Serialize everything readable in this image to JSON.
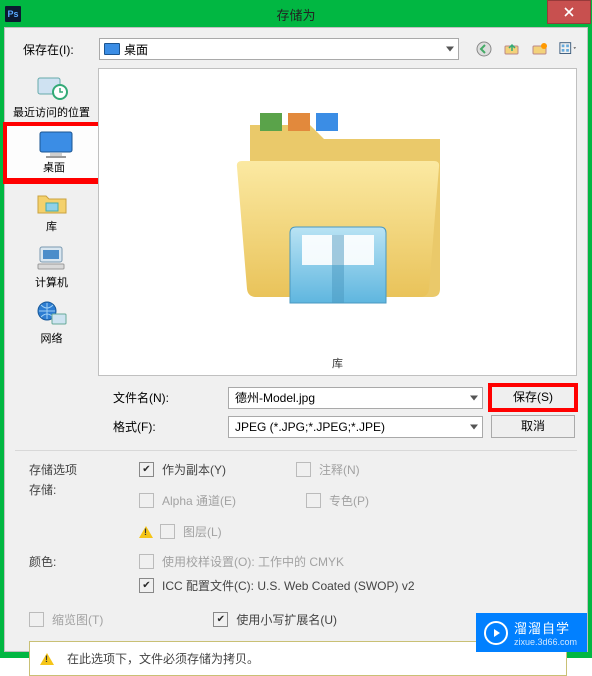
{
  "window": {
    "title": "存储为",
    "app_icon_label": "Ps"
  },
  "toolbar": {
    "save_in_label": "保存在(I):",
    "location": "桌面",
    "nav": {
      "back": "back",
      "up": "up",
      "new_folder": "new-folder",
      "view": "view"
    }
  },
  "places": {
    "recent": "最近访问的位置",
    "desktop": "桌面",
    "libraries": "库",
    "computer": "计算机",
    "network": "网络"
  },
  "content": {
    "selected_label": "库"
  },
  "form": {
    "filename_label": "文件名(N):",
    "filename_value": "德州-Model.jpg",
    "format_label": "格式(F):",
    "format_value": "JPEG (*.JPG;*.JPEG;*.JPE)",
    "save_btn": "保存(S)",
    "cancel_btn": "取消"
  },
  "options": {
    "section_title": "存储选项",
    "store_label": "存储:",
    "as_copy": "作为副本(Y)",
    "notes": "注释(N)",
    "alpha": "Alpha 通道(E)",
    "spot": "专色(P)",
    "layers": "图层(L)",
    "color_label": "颜色:",
    "use_proof": "使用校样设置(O): 工作中的 CMYK",
    "icc_profile": "ICC 配置文件(C): U.S. Web Coated (SWOP) v2",
    "thumbnail": "缩览图(T)",
    "lowercase_ext": "使用小写扩展名(U)",
    "info_msg": "在此选项下，文件必须存储为拷贝。"
  },
  "watermark": {
    "brand": "溜溜自学",
    "sub": "zixue.3d66.com"
  }
}
